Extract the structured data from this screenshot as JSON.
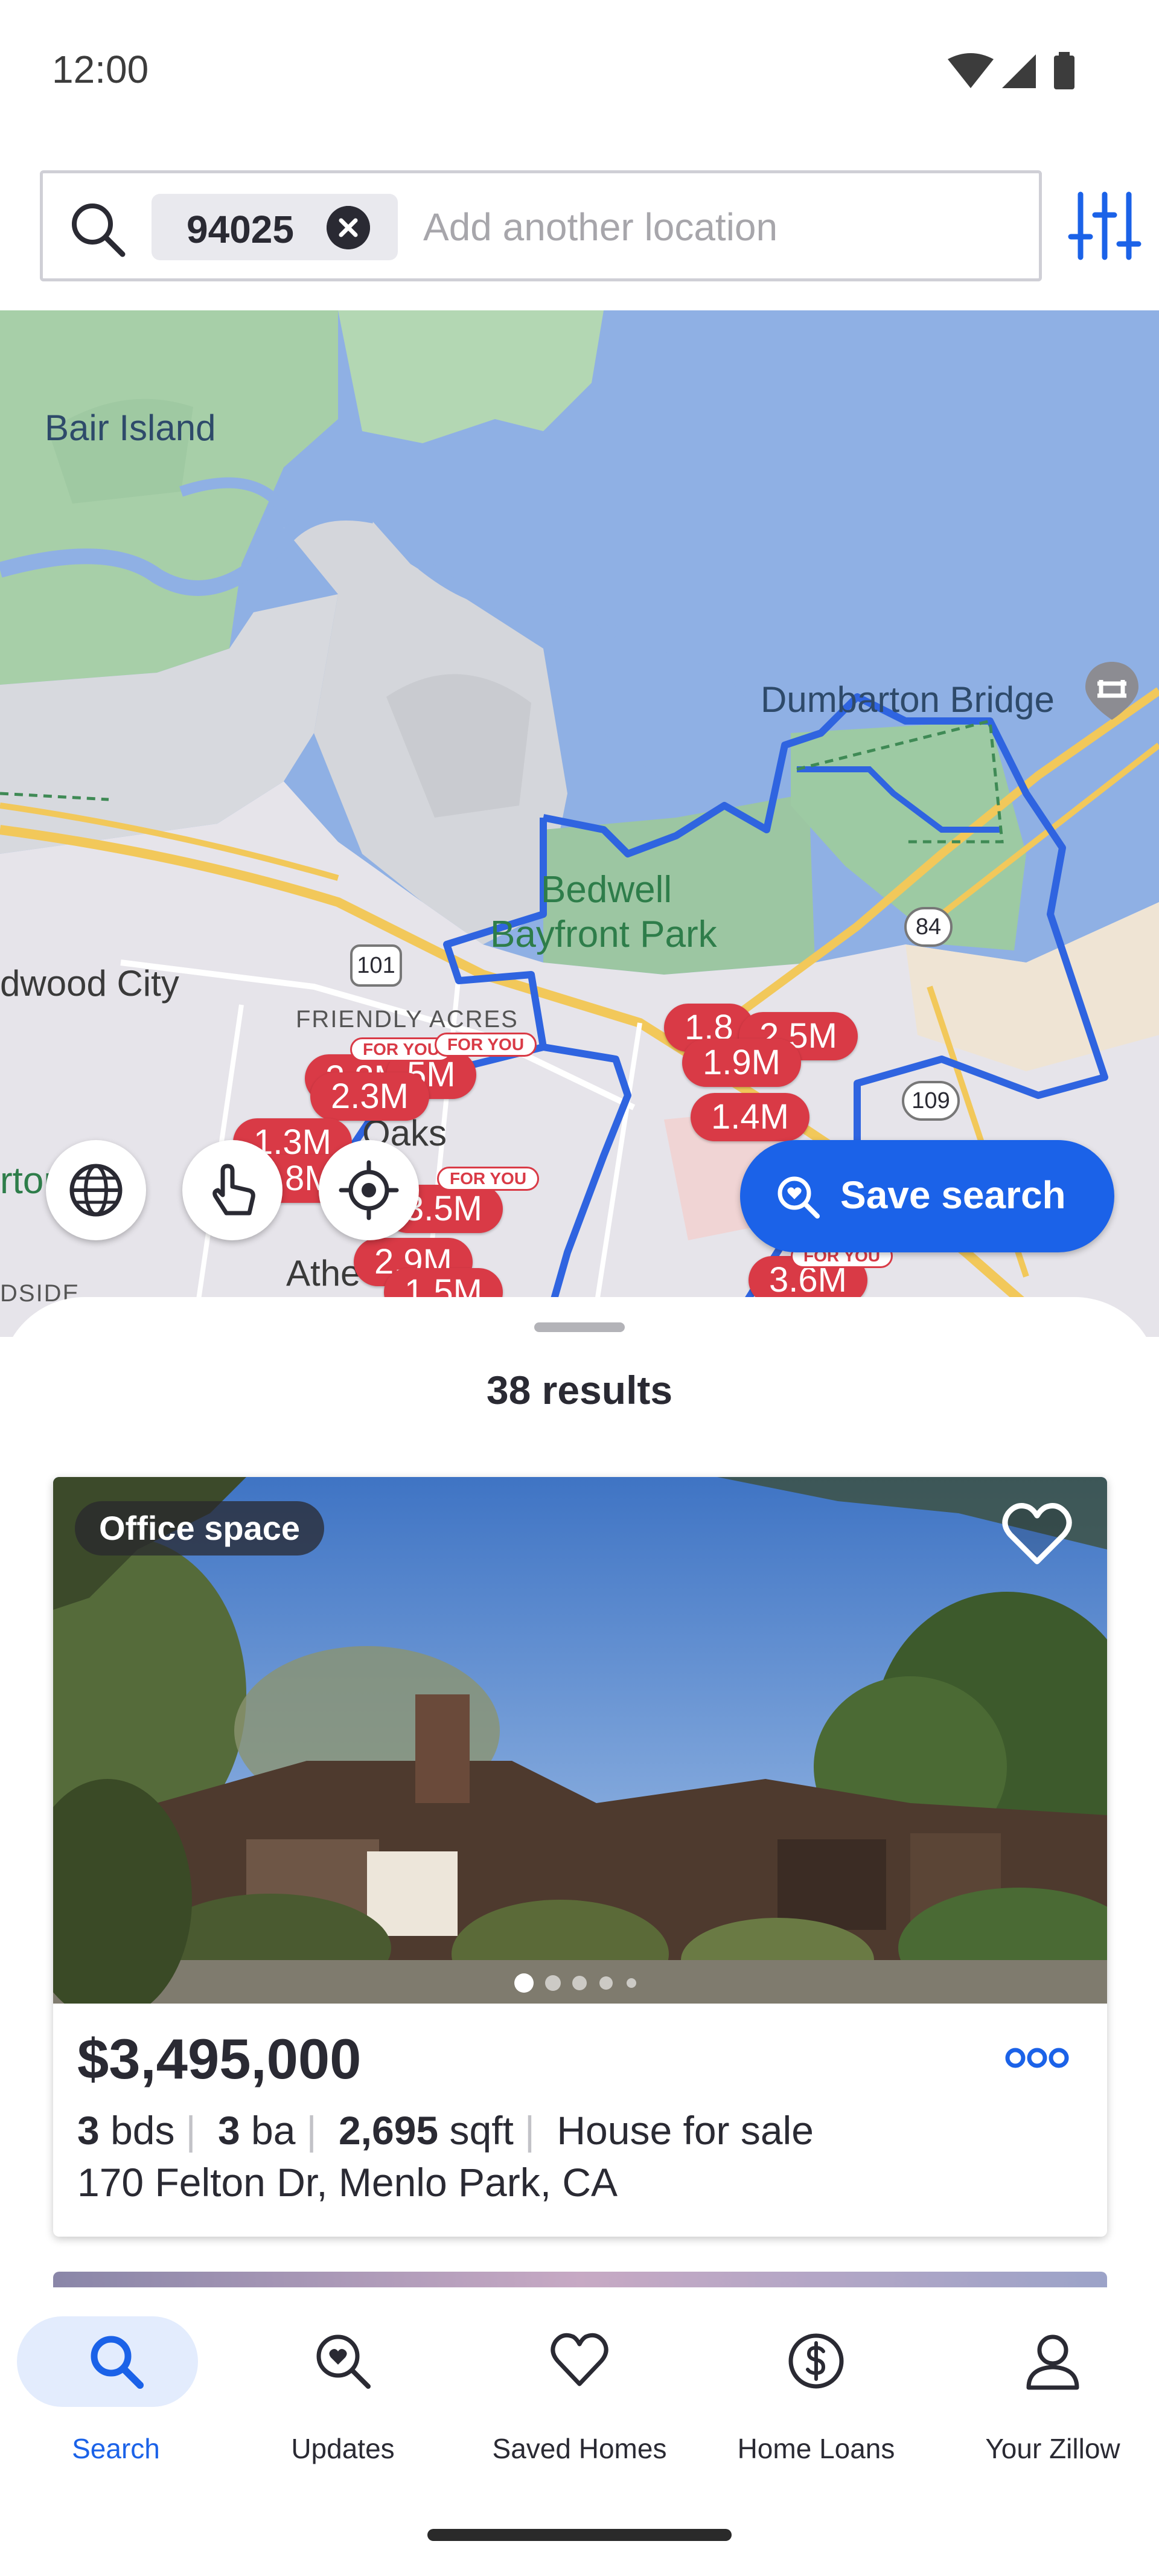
{
  "status_bar": {
    "time": "12:00",
    "icons": [
      "wifi-icon",
      "cellular-signal-icon",
      "battery-icon"
    ]
  },
  "search": {
    "chip_label": "94025",
    "placeholder": "Add another location",
    "value": ""
  },
  "map": {
    "labels": {
      "bair_island": "Bair Island",
      "dumbarton_bridge": "Dumbarton Bridge",
      "bedwell": "Bedwell",
      "bayfront_park": "Bayfront Park",
      "redwood_city": "dwood City",
      "friendly_acres": "FRIENDLY ACRES",
      "oaks": "Oaks",
      "atherton": "Athe",
      "hwy_101": "101",
      "hwy_84": "84",
      "hwy_109": "109",
      "edge_ton": "rton",
      "edge_side": "DSIDE"
    },
    "pins": [
      {
        "label": "2.3M"
      },
      {
        "label": "5M"
      },
      {
        "label": "2.3M"
      },
      {
        "label": "1.3M"
      },
      {
        "label": "8M"
      },
      {
        "label": "3.5M"
      },
      {
        "label": "2.9M"
      },
      {
        "label": "1.5M"
      },
      {
        "label": "1.8"
      },
      {
        "label": "2.5M"
      },
      {
        "label": "1.9M"
      },
      {
        "label": "1.4M"
      },
      {
        "label": "3.6M"
      }
    ],
    "for_you_tag": "FOR YOU",
    "save_search_label": "Save search",
    "accent_color": "#1b62e8",
    "pin_color": "#d93a46"
  },
  "results": {
    "count_label": "38 results"
  },
  "listing": {
    "badge": "Office space",
    "price": "$3,495,000",
    "beds": "3",
    "beds_unit": "bds",
    "baths": "3",
    "baths_unit": "ba",
    "sqft": "2,695",
    "sqft_unit": "sqft",
    "type": "House for sale",
    "address": "170 Felton Dr, Menlo Park, CA",
    "photo_index": 1,
    "photo_count": 5
  },
  "nav": {
    "items": [
      {
        "label": "Search",
        "icon": "search-icon",
        "active": true
      },
      {
        "label": "Updates",
        "icon": "updates-icon",
        "active": false
      },
      {
        "label": "Saved Homes",
        "icon": "heart-icon",
        "active": false
      },
      {
        "label": "Home Loans",
        "icon": "dollar-icon",
        "active": false
      },
      {
        "label": "Your Zillow",
        "icon": "person-icon",
        "active": false
      }
    ]
  }
}
